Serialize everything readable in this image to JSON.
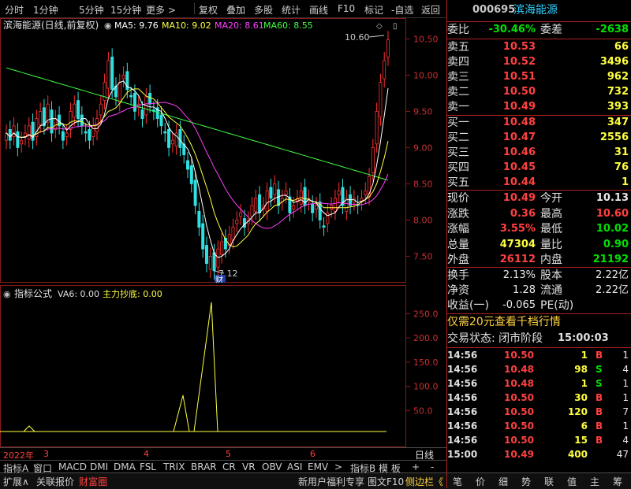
{
  "toolbar": {
    "items": [
      "分时",
      "1分钟",
      "5分钟",
      "15分钟",
      "更多 >",
      "复权",
      "叠加",
      "多股",
      "统计",
      "画线",
      "F10",
      "标记",
      "-自选",
      "返回"
    ]
  },
  "main_chart": {
    "title": "滨海能源(日线,前复权)",
    "ma_labels": [
      {
        "text": "MA5: 9.76",
        "color": "#ffffff"
      },
      {
        "text": "MA10: 9.02",
        "color": "#ffff40"
      },
      {
        "text": "MA20: 8.61",
        "color": "#ff40ff"
      },
      {
        "text": "MA60: 8.55",
        "color": "#40ff40"
      }
    ],
    "y_ticks": [
      "10.50",
      "10.00",
      "9.50",
      "9.00",
      "8.50",
      "8.00",
      "7.50"
    ],
    "high_marker": "10.60",
    "low_marker": "7.12",
    "event_badge": "财"
  },
  "sub_chart": {
    "title": "指标公式",
    "va6": "VA6: 0.00",
    "zhuli": "主力抄底: 0.00",
    "y_ticks": [
      "250.0",
      "200.0",
      "150.0",
      "100.0",
      "50.0"
    ]
  },
  "x_axis": {
    "year": "2022年",
    "months": [
      "3",
      "4",
      "5",
      "6"
    ],
    "right_label": "日线"
  },
  "chart_data": [
    {
      "type": "candlestick",
      "title": "滨海能源(日线,前复权)",
      "ylim": [
        7.2,
        10.7
      ],
      "annotations": [
        "10.60",
        "7.12"
      ]
    },
    {
      "type": "line",
      "title": "主力抄底",
      "ylim": [
        0,
        280
      ],
      "y_ticks": [
        50,
        100,
        150,
        200,
        250
      ]
    }
  ],
  "quote": {
    "code": "000695",
    "name": "滨海能源",
    "weibi_label": "委比",
    "weibi": "-30.46%",
    "weicha_label": "委差",
    "weicha": "-2638",
    "sells": [
      {
        "label": "卖五",
        "price": "10.53",
        "vol": "66"
      },
      {
        "label": "卖四",
        "price": "10.52",
        "vol": "3496"
      },
      {
        "label": "卖三",
        "price": "10.51",
        "vol": "962"
      },
      {
        "label": "卖二",
        "price": "10.50",
        "vol": "732"
      },
      {
        "label": "卖一",
        "price": "10.49",
        "vol": "393"
      }
    ],
    "buys": [
      {
        "label": "买一",
        "price": "10.48",
        "vol": "347"
      },
      {
        "label": "买二",
        "price": "10.47",
        "vol": "2556"
      },
      {
        "label": "买三",
        "price": "10.46",
        "vol": "31"
      },
      {
        "label": "买四",
        "price": "10.45",
        "vol": "76"
      },
      {
        "label": "买五",
        "price": "10.44",
        "vol": "1"
      }
    ],
    "stats": [
      {
        "l1": "现价",
        "v1": "10.49",
        "c1": "red",
        "l2": "今开",
        "v2": "10.13",
        "c2": "white"
      },
      {
        "l1": "涨跌",
        "v1": "0.36",
        "c1": "red",
        "l2": "最高",
        "v2": "10.60",
        "c2": "red"
      },
      {
        "l1": "涨幅",
        "v1": "3.55%",
        "c1": "red",
        "l2": "最低",
        "v2": "10.02",
        "c2": "green"
      },
      {
        "l1": "总量",
        "v1": "47304",
        "c1": "yellow",
        "l2": "量比",
        "v2": "0.90",
        "c2": "green"
      },
      {
        "l1": "外盘",
        "v1": "26112",
        "c1": "red",
        "l2": "内盘",
        "v2": "21192",
        "c2": "green"
      }
    ],
    "stats2": [
      {
        "l1": "换手",
        "v1": "2.13%",
        "l2": "股本",
        "v2": "2.22亿"
      },
      {
        "l1": "净资",
        "v1": "1.28",
        "l2": "流通",
        "v2": "2.22亿"
      },
      {
        "l1": "收益(一)",
        "v1": "-0.065",
        "l2": "PE(动)",
        "v2": ""
      }
    ],
    "promo": "仅需20元查看千档行情",
    "status_label": "交易状态: 闭市阶段",
    "status_time": "15:00:03",
    "ticks": [
      {
        "t": "14:56",
        "p": "10.50",
        "v": "1",
        "s": "B",
        "n": "1"
      },
      {
        "t": "14:56",
        "p": "10.48",
        "v": "98",
        "s": "S",
        "n": "4"
      },
      {
        "t": "14:56",
        "p": "10.48",
        "v": "1",
        "s": "S",
        "n": "1"
      },
      {
        "t": "14:56",
        "p": "10.50",
        "v": "30",
        "s": "B",
        "n": "1"
      },
      {
        "t": "14:56",
        "p": "10.50",
        "v": "120",
        "s": "B",
        "n": "7"
      },
      {
        "t": "14:56",
        "p": "10.50",
        "v": "6",
        "s": "B",
        "n": "1"
      },
      {
        "t": "14:56",
        "p": "10.50",
        "v": "15",
        "s": "B",
        "n": "4"
      },
      {
        "t": "15:00",
        "p": "10.49",
        "v": "400",
        "s": "",
        "n": "47"
      }
    ]
  },
  "tabs1": [
    "指标A",
    "窗口",
    "MACD",
    "DMI",
    "DMA",
    "FSL",
    "TRIX",
    "BRAR",
    "CR",
    "VR",
    "OBV",
    "ASI",
    "EMV",
    ">",
    "指标B",
    "模 板",
    "+",
    "-"
  ],
  "tabs2": [
    "扩展∧",
    "关联报价",
    "财富圈",
    "新用户福利专享",
    "图文F10",
    "侧边栏《"
  ],
  "right_tabs": [
    "笔",
    "价",
    "细",
    "势",
    "联",
    "值",
    "主",
    "筹"
  ]
}
